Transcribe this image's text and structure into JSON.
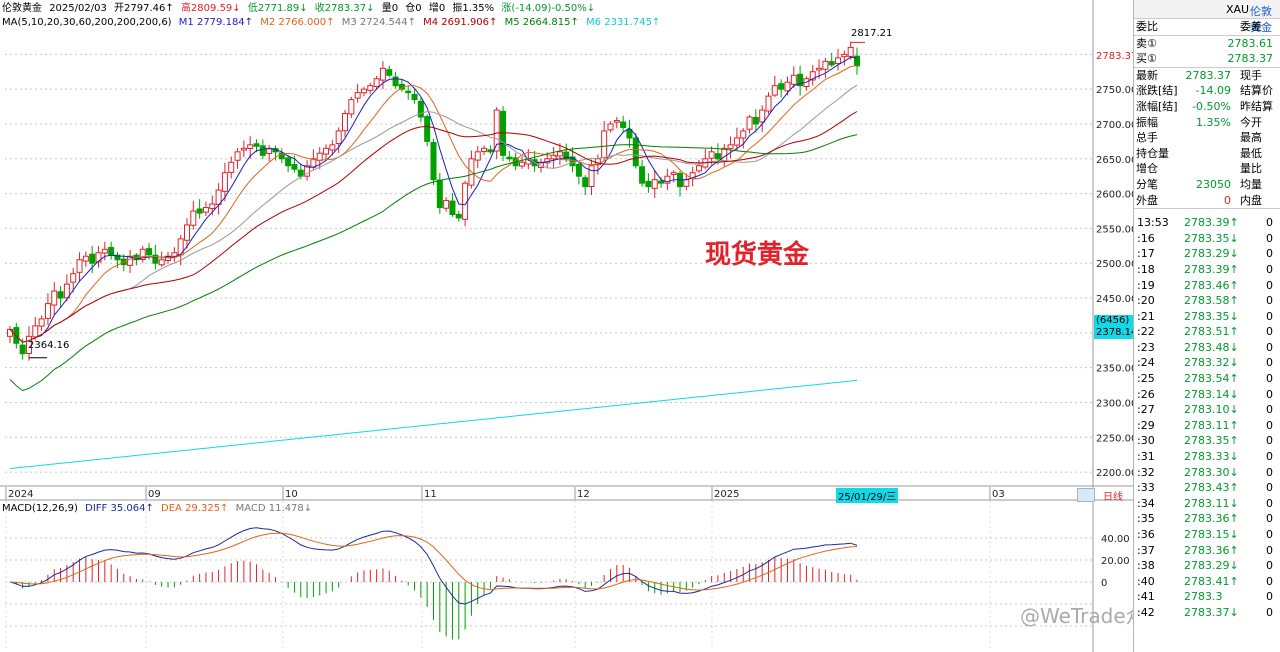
{
  "header": {
    "instrument": "伦敦黄金",
    "date": "2025/02/03",
    "open": "开2797.46↑",
    "high": "高2809.59↓",
    "low": "低2771.89↓",
    "close": "收2783.37↓",
    "volume": "量0",
    "oi": "仓0",
    "inc": "增0",
    "amplitude": "振1.35%",
    "change": "涨(-14.09)-0.50%↓"
  },
  "ma_line": {
    "label": "MA(5,10,20,30,60,200,200,200,6)",
    "m1": "M1 2779.184↑",
    "m2": "M2 2766.000↑",
    "m3": "M3 2724.544↑",
    "m4": "M4 2691.906↑",
    "m5": "M5 2664.815↑",
    "m6": "M6 2331.745↑"
  },
  "macd_line": {
    "label": "MACD(12,26,9)",
    "diff": "DIFF 35.064↑",
    "dea": "DEA 29.325↑",
    "macd": "MACD 11.478↓"
  },
  "annotation": "现货黄金",
  "watermark": "@WeTrade众汇官方",
  "price_labels": {
    "high_mark": "2817.21",
    "low_mark": "2364.16",
    "current": "2783.37",
    "ma200_tag_top": "(6456)",
    "ma200_tag_val": "2378.14"
  },
  "x_axis": {
    "labels": [
      "2024",
      "09",
      "10",
      "11",
      "12",
      "2025",
      "03"
    ],
    "cursor_date": "25/01/29/三",
    "period": "日线"
  },
  "colors": {
    "up": "#e0222a",
    "down": "#00a000",
    "ma5": "#1a1fbf",
    "ma10": "#e0651a",
    "ma20": "#9a9a9a",
    "ma30": "#b00000",
    "ma60": "#008000",
    "ma200": "#11d9e8",
    "diff": "#1d2a9a",
    "dea": "#e0651a"
  },
  "right_panel": {
    "symbol": "XAU",
    "name": "伦敦黄金",
    "ratio_label": "委比",
    "diff_label": "委差",
    "sell_label": "卖①",
    "sell_val": "2783.61",
    "buy_label": "买①",
    "buy_val": "2783.37",
    "stats": [
      {
        "l": "最新",
        "v": "2783.37",
        "r": "现手"
      },
      {
        "l": "涨跌[结]",
        "v": "-14.09",
        "r": "结算价"
      },
      {
        "l": "涨幅[结]",
        "v": "-0.50%",
        "r": "昨结算"
      },
      {
        "l": "振幅",
        "v": "1.35%",
        "r": "今开"
      },
      {
        "l": "总手",
        "v": "",
        "r": "最高"
      },
      {
        "l": "持仓量",
        "v": "",
        "r": "最低"
      },
      {
        "l": "增仓",
        "v": "",
        "r": "量比"
      },
      {
        "l": "分笔",
        "v": "23050",
        "r": "均量"
      },
      {
        "l": "外盘",
        "v": "0",
        "r": "内盘"
      }
    ],
    "ticks": [
      {
        "t": "13:53",
        "p": "2783.39↑",
        "q": "0"
      },
      {
        "t": ":16",
        "p": "2783.35↓",
        "q": "0"
      },
      {
        "t": ":17",
        "p": "2783.29↓",
        "q": "0"
      },
      {
        "t": ":18",
        "p": "2783.39↑",
        "q": "0"
      },
      {
        "t": ":19",
        "p": "2783.46↑",
        "q": "0"
      },
      {
        "t": ":20",
        "p": "2783.58↑",
        "q": "0"
      },
      {
        "t": ":21",
        "p": "2783.35↓",
        "q": "0"
      },
      {
        "t": ":22",
        "p": "2783.51↑",
        "q": "0"
      },
      {
        "t": ":23",
        "p": "2783.48↓",
        "q": "0"
      },
      {
        "t": ":24",
        "p": "2783.32↓",
        "q": "0"
      },
      {
        "t": ":25",
        "p": "2783.54↑",
        "q": "0"
      },
      {
        "t": ":26",
        "p": "2783.14↓",
        "q": "0"
      },
      {
        "t": ":27",
        "p": "2783.10↓",
        "q": "0"
      },
      {
        "t": ":29",
        "p": "2783.11↑",
        "q": "0"
      },
      {
        "t": ":30",
        "p": "2783.35↑",
        "q": "0"
      },
      {
        "t": ":31",
        "p": "2783.33↓",
        "q": "0"
      },
      {
        "t": ":32",
        "p": "2783.30↓",
        "q": "0"
      },
      {
        "t": ":33",
        "p": "2783.43↑",
        "q": "0"
      },
      {
        "t": ":34",
        "p": "2783.11↓",
        "q": "0"
      },
      {
        "t": ":35",
        "p": "2783.36↑",
        "q": "0"
      },
      {
        "t": ":36",
        "p": "2783.15↓",
        "q": "0"
      },
      {
        "t": ":37",
        "p": "2783.36↑",
        "q": "0"
      },
      {
        "t": ":38",
        "p": "2783.29↓",
        "q": "0"
      },
      {
        "t": ":40",
        "p": "2783.41↑",
        "q": "0"
      },
      {
        "t": ":41",
        "p": "2783.3",
        "q": "0"
      },
      {
        "t": ":42",
        "p": "2783.37↓",
        "q": "0"
      }
    ]
  },
  "chart_data": [
    {
      "type": "candlestick",
      "title": "伦敦黄金 日线",
      "ylim": [
        2180,
        2835
      ],
      "y_ticks": [
        2200,
        2250,
        2300,
        2350,
        2400,
        2450,
        2500,
        2550,
        2600,
        2650,
        2700,
        2750,
        2800
      ],
      "y_tick_labels": [
        "2200.00",
        "2250.00",
        "2300.00",
        "2350.00",
        "2400.00",
        "2450.00",
        "2500.00",
        "2550.00",
        "2600.00",
        "2650.00",
        "2700.00",
        "2750.00",
        "2800.00"
      ],
      "close": [
        2405,
        2385,
        2370,
        2395,
        2410,
        2420,
        2442,
        2460,
        2450,
        2470,
        2485,
        2505,
        2510,
        2500,
        2515,
        2520,
        2512,
        2505,
        2498,
        2510,
        2505,
        2520,
        2512,
        2500,
        2505,
        2510,
        2515,
        2535,
        2555,
        2575,
        2572,
        2580,
        2585,
        2605,
        2630,
        2645,
        2660,
        2665,
        2670,
        2668,
        2655,
        2665,
        2660,
        2650,
        2640,
        2635,
        2625,
        2640,
        2650,
        2658,
        2665,
        2670,
        2690,
        2715,
        2735,
        2745,
        2750,
        2755,
        2765,
        2780,
        2770,
        2755,
        2750,
        2745,
        2735,
        2710,
        2675,
        2620,
        2580,
        2590,
        2570,
        2565,
        2615,
        2650,
        2660,
        2665,
        2660,
        2720,
        2655,
        2650,
        2640,
        2645,
        2650,
        2640,
        2645,
        2650,
        2655,
        2660,
        2650,
        2640,
        2625,
        2610,
        2640,
        2650,
        2690,
        2700,
        2705,
        2695,
        2680,
        2640,
        2615,
        2610,
        2620,
        2615,
        2625,
        2630,
        2610,
        2620,
        2630,
        2640,
        2650,
        2660,
        2650,
        2665,
        2670,
        2680,
        2690,
        2710,
        2700,
        2720,
        2740,
        2755,
        2750,
        2760,
        2770,
        2755,
        2765,
        2775,
        2780,
        2790,
        2785,
        2795,
        2800,
        2810,
        2783.37
      ],
      "series": [
        {
          "name": "MA5",
          "value": "2779.184"
        },
        {
          "name": "MA10",
          "value": "2766.000"
        },
        {
          "name": "MA20",
          "value": "2724.544"
        },
        {
          "name": "MA30",
          "value": "2691.906"
        },
        {
          "name": "MA60",
          "value": "2664.815"
        },
        {
          "name": "MA200",
          "value": "2331.745"
        }
      ],
      "annotations": [
        "2817.21",
        "2364.16"
      ]
    },
    {
      "type": "bar",
      "title": "MACD(12,26,9)",
      "ylim": [
        -60,
        60
      ],
      "y_ticks": [
        40,
        20,
        0
      ],
      "y_tick_labels": [
        "40.00",
        "20.00",
        "0"
      ],
      "series": [
        {
          "name": "DIFF",
          "last": 35.064
        },
        {
          "name": "DEA",
          "last": 29.325
        },
        {
          "name": "MACD",
          "last": 11.478
        }
      ]
    }
  ]
}
